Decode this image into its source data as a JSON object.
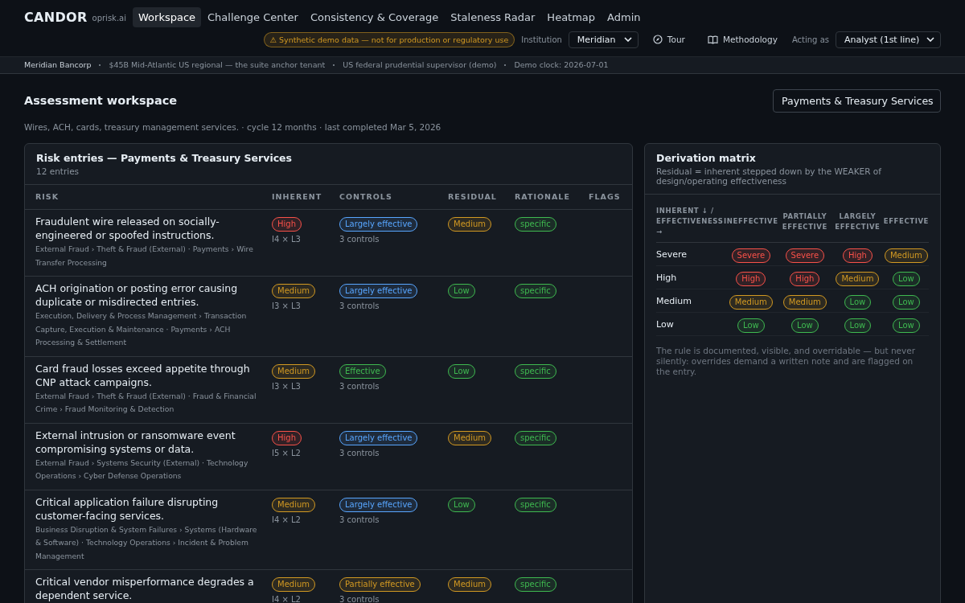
{
  "brand": {
    "name": "CANDOR",
    "domain": "oprisk.ai"
  },
  "nav": [
    {
      "label": "Workspace",
      "selected": true
    },
    {
      "label": "Challenge Center",
      "selected": false
    },
    {
      "label": "Consistency & Coverage",
      "selected": false
    },
    {
      "label": "Staleness Radar",
      "selected": false
    },
    {
      "label": "Heatmap",
      "selected": false
    },
    {
      "label": "Admin",
      "selected": false
    }
  ],
  "header": {
    "demo_notice": "⚠ Synthetic demo data — not for production or regulatory use",
    "institution_label": "Institution",
    "institution": "Meridian",
    "tour": "Tour",
    "methodology": "Methodology",
    "acting_label": "Acting as",
    "acting_as": "Analyst (1st line)"
  },
  "context_bar": [
    "Meridian Bancorp",
    "$45B Mid-Atlantic US regional — the suite anchor tenant",
    "US federal prudential supervisor (demo)",
    "Demo clock: 2026-07-01"
  ],
  "page": {
    "title": "Assessment workspace",
    "unit": "Payments & Treasury Services",
    "description": "Wires, ACH, cards, treasury management services. · cycle 12 months · last completed Mar 5, 2026"
  },
  "risk_table": {
    "title": "Risk entries — Payments & Treasury Services",
    "count": "12 entries",
    "columns": [
      "RISK",
      "INHERENT",
      "CONTROLS",
      "RESIDUAL",
      "RATIONALE",
      "FLAGS"
    ],
    "rows": [
      {
        "title": "Fraudulent wire released on socially-engineered or spoofed instructions.",
        "path": "External Fraud › Theft & Fraud (External) · Payments › Wire Transfer Processing",
        "inherent": {
          "label": "High",
          "color": "#f85149"
        },
        "score": "I4 × L3",
        "controls": {
          "label": "Largely effective",
          "color": "#58a6ff"
        },
        "control_count": "3 controls",
        "residual": {
          "label": "Medium",
          "color": "#d29922"
        },
        "rationale": {
          "label": "specific",
          "color": "#3fb950"
        }
      },
      {
        "title": "ACH origination or posting error causing duplicate or misdirected entries.",
        "path": "Execution, Delivery & Process Management › Transaction Capture, Execution & Maintenance · Payments › ACH Processing & Settlement",
        "inherent": {
          "label": "Medium",
          "color": "#d29922"
        },
        "score": "I3 × L3",
        "controls": {
          "label": "Largely effective",
          "color": "#58a6ff"
        },
        "control_count": "3 controls",
        "residual": {
          "label": "Low",
          "color": "#3fb950"
        },
        "rationale": {
          "label": "specific",
          "color": "#3fb950"
        }
      },
      {
        "title": "Card fraud losses exceed appetite through CNP attack campaigns.",
        "path": "External Fraud › Theft & Fraud (External) · Fraud & Financial Crime › Fraud Monitoring & Detection",
        "inherent": {
          "label": "Medium",
          "color": "#d29922"
        },
        "score": "I3 × L3",
        "controls": {
          "label": "Effective",
          "color": "#3fb950"
        },
        "control_count": "3 controls",
        "residual": {
          "label": "Low",
          "color": "#3fb950"
        },
        "rationale": {
          "label": "specific",
          "color": "#3fb950"
        }
      },
      {
        "title": "External intrusion or ransomware event compromising systems or data.",
        "path": "External Fraud › Systems Security (External) · Technology Operations › Cyber Defense Operations",
        "inherent": {
          "label": "High",
          "color": "#f85149"
        },
        "score": "I5 × L2",
        "controls": {
          "label": "Largely effective",
          "color": "#58a6ff"
        },
        "control_count": "3 controls",
        "residual": {
          "label": "Medium",
          "color": "#d29922"
        },
        "rationale": {
          "label": "specific",
          "color": "#3fb950"
        }
      },
      {
        "title": "Critical application failure disrupting customer-facing services.",
        "path": "Business Disruption & System Failures › Systems (Hardware & Software) · Technology Operations › Incident & Problem Management",
        "inherent": {
          "label": "Medium",
          "color": "#d29922"
        },
        "score": "I4 × L2",
        "controls": {
          "label": "Largely effective",
          "color": "#58a6ff"
        },
        "control_count": "3 controls",
        "residual": {
          "label": "Low",
          "color": "#3fb950"
        },
        "rationale": {
          "label": "specific",
          "color": "#3fb950"
        }
      },
      {
        "title": "Critical vendor misperformance degrades a dependent service.",
        "inherent": {
          "label": "Medium",
          "color": "#d29922"
        },
        "score": "I4 × L2",
        "controls": {
          "label": "Partially effective",
          "color": "#d29922"
        },
        "control_count": "3 controls",
        "residual": {
          "label": "Medium",
          "color": "#d29922"
        },
        "rationale": {
          "label": "specific",
          "color": "#3fb950"
        }
      }
    ]
  },
  "matrix": {
    "title": "Derivation matrix",
    "subtitle": "Residual = inherent stepped down by the WEAKER of design/operating effectiveness",
    "corner_label": "INHERENT ↓ / EFFECTIVENESS →",
    "columns": [
      "INEFFECTIVE",
      "PARTIALLY EFFECTIVE",
      "LARGELY EFFECTIVE",
      "EFFECTIVE"
    ],
    "rows": [
      {
        "label": "Severe",
        "cells": [
          {
            "label": "Severe",
            "color": "#f85149"
          },
          {
            "label": "Severe",
            "color": "#f85149"
          },
          {
            "label": "High",
            "color": "#f85149"
          },
          {
            "label": "Medium",
            "color": "#d29922"
          }
        ]
      },
      {
        "label": "High",
        "cells": [
          {
            "label": "High",
            "color": "#f85149"
          },
          {
            "label": "High",
            "color": "#f85149"
          },
          {
            "label": "Medium",
            "color": "#d29922"
          },
          {
            "label": "Low",
            "color": "#3fb950"
          }
        ]
      },
      {
        "label": "Medium",
        "cells": [
          {
            "label": "Medium",
            "color": "#d29922"
          },
          {
            "label": "Medium",
            "color": "#d29922"
          },
          {
            "label": "Low",
            "color": "#3fb950"
          },
          {
            "label": "Low",
            "color": "#3fb950"
          }
        ]
      },
      {
        "label": "Low",
        "cells": [
          {
            "label": "Low",
            "color": "#3fb950"
          },
          {
            "label": "Low",
            "color": "#3fb950"
          },
          {
            "label": "Low",
            "color": "#3fb950"
          },
          {
            "label": "Low",
            "color": "#3fb950"
          }
        ]
      }
    ],
    "note": "The rule is documented, visible, and overridable — but never silently: overrides demand a written note and are flagged on the entry."
  }
}
